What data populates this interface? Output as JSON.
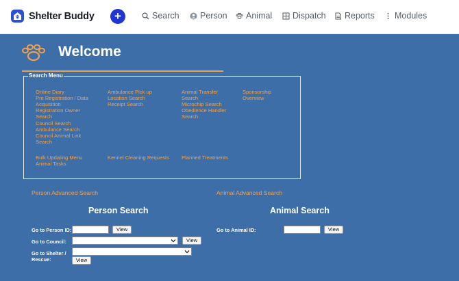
{
  "brand": {
    "name": "Shelter Buddy"
  },
  "nav": {
    "plus": "+",
    "search": "Search",
    "person": "Person",
    "animal": "Animal",
    "dispatch": "Dispatch",
    "reports": "Reports",
    "modules": "Modules"
  },
  "welcome": {
    "title": "Welcome"
  },
  "search_menu": {
    "legend": "Search Menu",
    "col1": [
      "Online Diary",
      "Pre Registration / Data",
      "Acquisition",
      "Registration Owner",
      "Search",
      "Council Search",
      "Ambulance Search",
      "Council Animal Link",
      "Search"
    ],
    "col2": [
      "Ambulance Pick up",
      "Location Search",
      "Receipt Search"
    ],
    "col3": [
      "Animal Transfer",
      "Search",
      "Microchip Search",
      "Obedience Handler",
      "Search"
    ],
    "col4": [
      "Sponsorship",
      "Overview"
    ],
    "bottom1": [
      "Bulk Updating Menu",
      "Animal Tasks"
    ],
    "bottom2": [
      "Kennel Cleaning Requests"
    ],
    "bottom3": [
      "Planned Treatments"
    ]
  },
  "person": {
    "advanced_link": "Person Advanced Search",
    "title": "Person Search",
    "id_label": "Go to Person ID:",
    "id_value": "",
    "council_label": "Go to Council:",
    "council_value": "",
    "shelter_label_1": "Go to Shelter /",
    "shelter_label_2": "Rescue:",
    "shelter_value": "",
    "view": "View"
  },
  "animal": {
    "advanced_link": "Animal Advanced Search",
    "title": "Animal Search",
    "id_label": "Go to Animal ID:",
    "id_value": "",
    "view": "View"
  },
  "colors": {
    "background": "#3d6ea7",
    "accent": "#f0a24a",
    "brand": "#1f35d4"
  }
}
